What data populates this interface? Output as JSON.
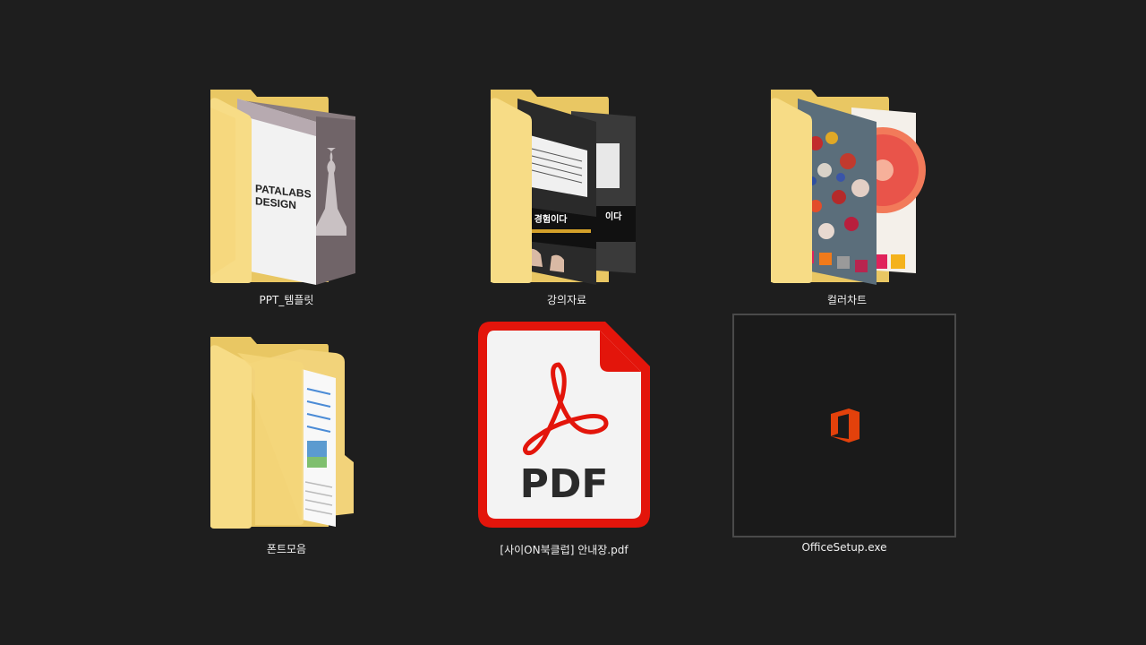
{
  "items": [
    {
      "name": "PPT_템플릿",
      "type": "folder",
      "preview_text": [
        "PATALABS",
        "DESIGN"
      ]
    },
    {
      "name": "강의자료",
      "type": "folder",
      "preview_text": [
        "는 경험이다",
        "이다"
      ]
    },
    {
      "name": "컬러차트",
      "type": "folder"
    },
    {
      "name": "폰트모음",
      "type": "folder"
    },
    {
      "name": "[사이ON북클럽] 안내장.pdf",
      "type": "pdf",
      "badge": "PDF",
      "accent": "#e3150b"
    },
    {
      "name": "OfficeSetup.exe",
      "type": "exe",
      "accent": "#e3410b"
    }
  ],
  "colors": {
    "background": "#1e1e1e",
    "folder": "#f5d77a",
    "folder_dark": "#e2b94c"
  }
}
